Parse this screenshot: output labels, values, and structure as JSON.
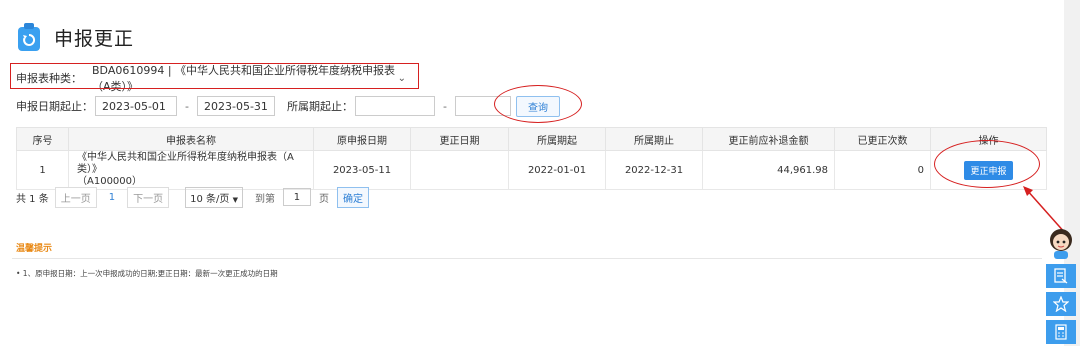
{
  "header": {
    "title": "申报更正"
  },
  "filters": {
    "type_label": "申报表种类：",
    "type_value": "BDA0610994 | 《中华人民共和国企业所得税年度纳税申报表（A类）》",
    "date_label": "申报日期起止：",
    "date_start": "2023-05-01",
    "date_end": "2023-05-31",
    "period_label": "所属期起止：",
    "period_start": "",
    "period_end": "",
    "dash": "-",
    "query_label": "查询"
  },
  "table": {
    "headers": [
      "序号",
      "申报表名称",
      "原申报日期",
      "更正日期",
      "所属期起",
      "所属期止",
      "更正前应补退金额",
      "已更正次数",
      "操作"
    ],
    "rows": [
      {
        "no": "1",
        "name_line1": "《中华人民共和国企业所得税年度纳税申报表（A类）》",
        "name_line2": "（A100000）",
        "orig_date": "2023-05-11",
        "corr_date": "",
        "period_start": "2022-01-01",
        "period_end": "2022-12-31",
        "amount": "44,961.98",
        "count": "0",
        "action": "更正申报"
      }
    ]
  },
  "pager": {
    "total": "共 1 条",
    "prev": "上一页",
    "page": "1",
    "next": "下一页",
    "size": "10 条/页",
    "size_arrow": "▼",
    "goto": "到第",
    "goto_value": "1",
    "page_unit": "页",
    "confirm": "确定"
  },
  "tips": {
    "title": "温馨提示",
    "line1": "• 1、原申报日期：上一次申报成功的日期;更正日期：最新一次更正成功的日期"
  },
  "colors": {
    "accent": "#2f8be6",
    "annotation": "#d62020",
    "tips": "#e98a17"
  }
}
